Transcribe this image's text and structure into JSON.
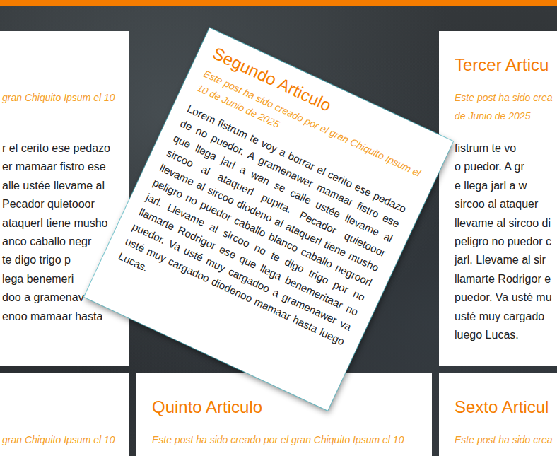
{
  "articles": [
    {
      "subtitle": [
        "gran Chiquito Ipsum el 10"
      ],
      "body": [
        "r el cerito ese pedazo",
        "er mamaar fistro ese",
        "alle ustée llevame al",
        "Pecador quietooor",
        "ataquerl tiene musho",
        "anco caballo negr",
        "te digo trigo p",
        "lega benemeri",
        "doo a gramenav",
        "enoo mamaar hasta"
      ],
      "hovered": false
    },
    {
      "title": "Segundo Articulo",
      "subtitle": [
        "Este post ha sido creado por el gran Chiquito Ipsum el 10 de Junio de 2025"
      ],
      "body": [
        "Lorem fistrum te voy a borrar el cerito ese pedazo de no puedor. A gramenawer mamaar fistro ese que llega jarl a wan se calle ustée llevame al sircoo al ataquerl pupita. Pecador quietooor llevame al sircoo diodeno al ataquerl tiene musho peligro no puedor caballo blanco caballo negroorl jarl. Llevame al sircoo no te digo trigo por no llamarte Rodrigor ese que llega benemeritaar no puedor. Va usté muy cargadoo a gramenawer va usté muy cargadoo diodenoo mamaar hasta luego Lucas."
      ],
      "hovered": true
    },
    {
      "title": "Tercer Articu",
      "subtitle": [
        "Este post ha sido crea",
        "de Junio de 2025"
      ],
      "body": [
        "fistrum te vo",
        "o puedor. A gr",
        "e llega jarl a w",
        "sircoo al ataquer",
        "llevame al sircoo di",
        "peligro no puedor c",
        "jarl. Llevame al sir",
        "llamarte Rodrigor e",
        "puedor. Va usté mu",
        "usté muy cargado",
        "luego Lucas."
      ],
      "hovered": false
    },
    {
      "subtitle": [
        "gran Chiquito Ipsum el 10"
      ],
      "body": [],
      "hovered": false
    },
    {
      "title": "Quinto Articulo",
      "subtitle": [
        "Este post ha sido creado por el gran Chiquito Ipsum el 10"
      ],
      "body": [],
      "hovered": false
    },
    {
      "title": "Sexto Articul",
      "subtitle": [
        "Este post ha sido crea"
      ],
      "body": [],
      "hovered": false
    }
  ]
}
